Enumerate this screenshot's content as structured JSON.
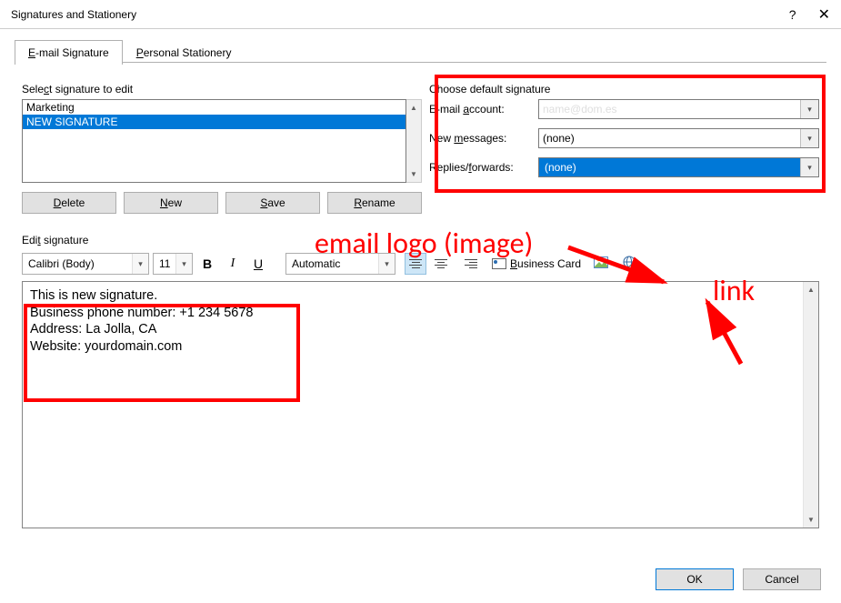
{
  "window": {
    "title": "Signatures and Stationery"
  },
  "tabs": {
    "email": "E-mail Signature",
    "stationery": "Personal Stationery"
  },
  "select_label": "Select signature to edit",
  "sig_items": [
    "Marketing",
    "NEW SIGNATURE"
  ],
  "buttons": {
    "delete": "Delete",
    "new": "New",
    "save": "Save",
    "rename": "Rename"
  },
  "defaults": {
    "heading": "Choose default signature",
    "account_label": "E-mail account:",
    "account_value": "name@dom.es",
    "newmsg_label": "New messages:",
    "newmsg_value": "(none)",
    "replies_label": "Replies/forwards:",
    "replies_value": "(none)"
  },
  "edit_label": "Edit signature",
  "toolbar": {
    "font": "Calibri (Body)",
    "size": "11",
    "auto": "Automatic",
    "bcard": "Business Card"
  },
  "signature_lines": [
    "This is new signature.",
    "Business phone number: +1 234 5678",
    "Address: La Jolla, CA",
    "Website: yourdomain.com"
  ],
  "dlg": {
    "ok": "OK",
    "cancel": "Cancel"
  },
  "annotations": {
    "logo": "email logo (image)",
    "link": "link"
  }
}
